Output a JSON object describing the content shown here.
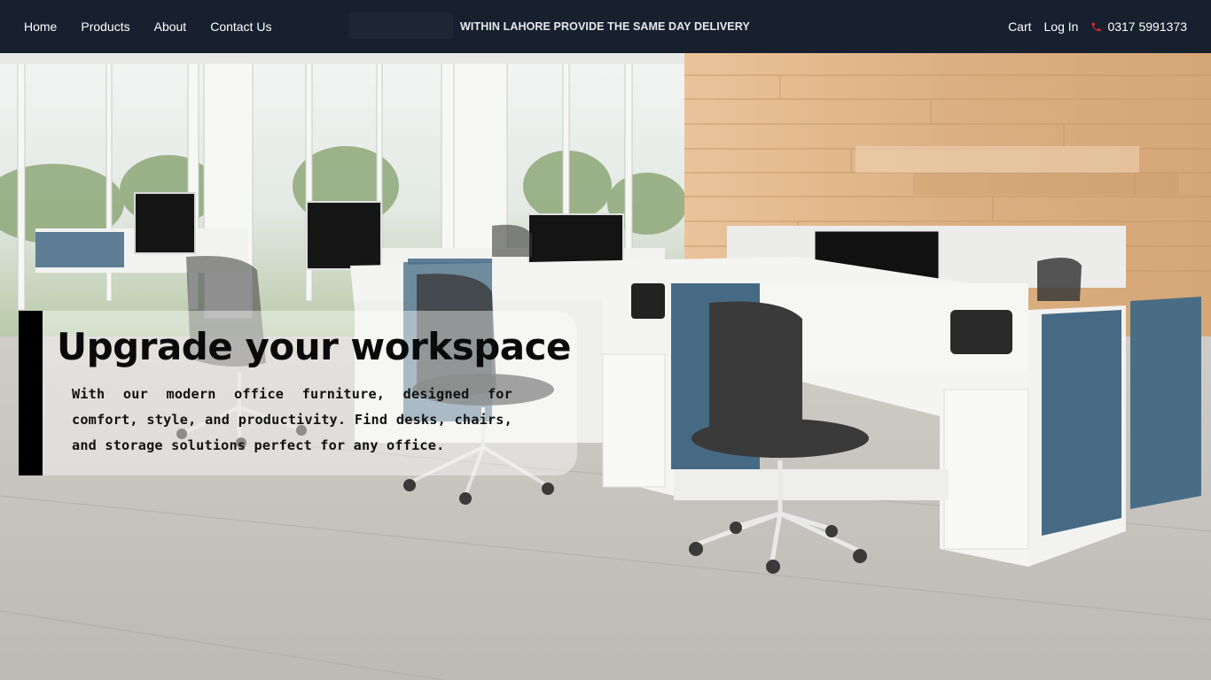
{
  "nav": {
    "links": [
      "Home",
      "Products",
      "About",
      "Contact Us"
    ],
    "banner": "WITHIN LAHORE PROVIDE THE SAME DAY DELIVERY",
    "cart": "Cart",
    "login": "Log In",
    "phone": "0317 5991373",
    "phone_icon": "phone-icon"
  },
  "hero": {
    "title": "Upgrade your workspace",
    "text": "With our modern office furniture, designed for comfort, style, and productivity. Find desks, chairs, and storage solutions perfect for any office."
  },
  "colors": {
    "nav_bg": "#17202e",
    "phone_icon": "#e0252b",
    "panel_blue": "#466a83"
  }
}
